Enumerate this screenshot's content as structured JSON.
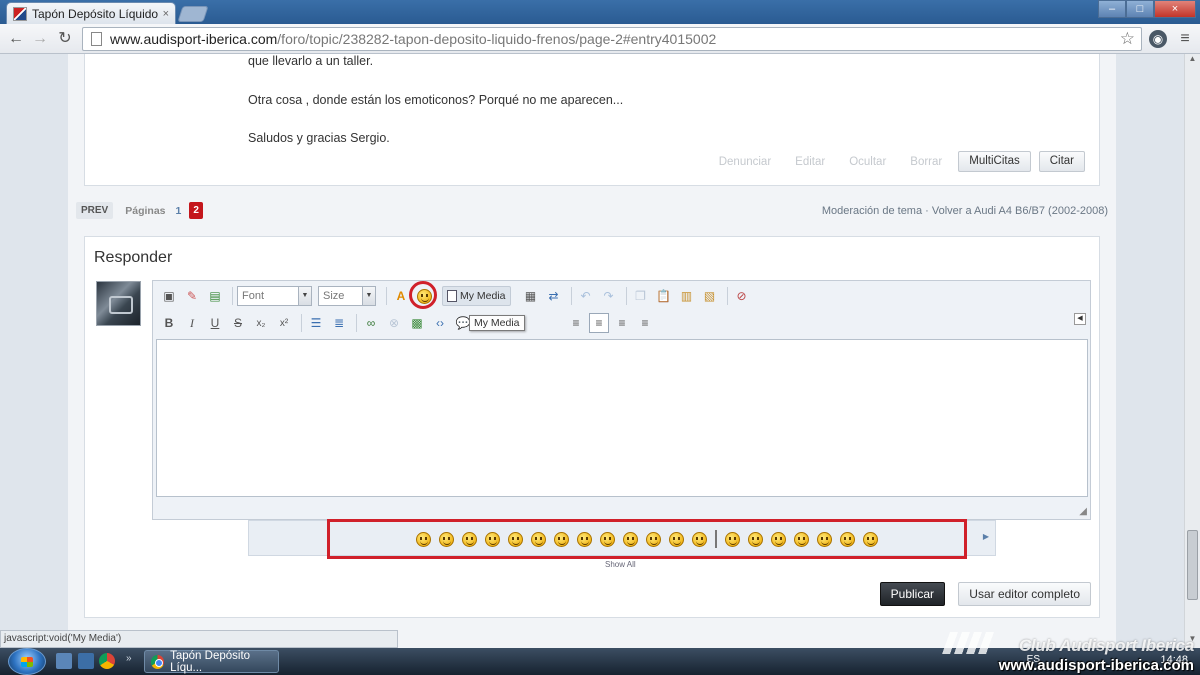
{
  "browser": {
    "tab_title": "Tapón Depósito Líquido F",
    "tab_close": "×",
    "url_host": "www.audisport-iberica.com",
    "url_path": "/foro/topic/238282-tapon-deposito-liquido-frenos/page-2#entry4015002",
    "window_controls": {
      "minimize": "–",
      "maximize": "□",
      "close": "×"
    },
    "nav": {
      "back": "←",
      "forward": "→",
      "reload": "↻",
      "bookmark": "☆",
      "menu": "≡"
    }
  },
  "post": {
    "lines": [
      "que llevarlo a un taller.",
      "Otra cosa , donde están los emoticonos? Porqué no me aparecen...",
      "Saludos y gracias Sergio."
    ],
    "actions": {
      "report": "Denunciar",
      "edit": "Editar",
      "hide": "Ocultar",
      "delete": "Borrar",
      "multiquote": "MultiCitas",
      "quote": "Citar"
    }
  },
  "pagination": {
    "prev": "PREV",
    "label": "Páginas",
    "page_1": "1",
    "page_2": "2"
  },
  "moderation": {
    "text": "Moderación de tema · Volver a Audi A4 B6/B7 (2002-2008)"
  },
  "reply": {
    "title": "Responder",
    "font_placeholder": "Font",
    "size_placeholder": "Size",
    "my_media_label": "My Media",
    "tooltip": "My Media",
    "show_all": "Show All",
    "publish": "Publicar",
    "full_editor": "Usar editor completo"
  },
  "toolbar_icons": {
    "bold": "B",
    "italic": "I",
    "underline": "U",
    "strike": "S",
    "subscript": "x₂",
    "superscript": "x²"
  },
  "status_bar": "javascript:void('My Media')",
  "taskbar": {
    "task_title": "Tapón Depósito Líqu...",
    "chevron": "»",
    "language": "ES",
    "clock": "14:48"
  },
  "watermark": {
    "name": "Club Audisport Iberica",
    "site": "www.audisport-iberica.com"
  },
  "colors": {
    "accent_red": "#d0202a",
    "page_current": "#c4161c",
    "publish_bg": "#2b3036"
  }
}
